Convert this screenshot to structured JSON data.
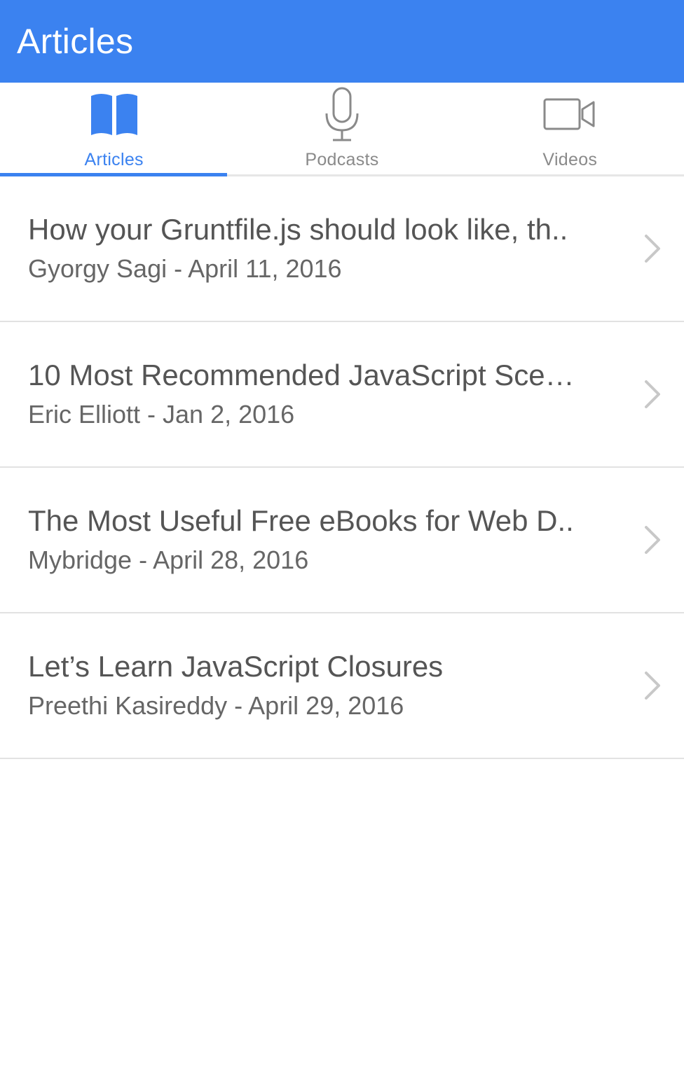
{
  "app_bar": {
    "title": "Articles"
  },
  "colors": {
    "accent": "#3b82f0",
    "inactive_icon": "#8a8a8a",
    "divider": "#e2e2e2",
    "chevron": "#c8c8c8"
  },
  "tabs": [
    {
      "label": "Articles",
      "icon": "book-icon",
      "active": true
    },
    {
      "label": "Podcasts",
      "icon": "microphone-icon",
      "active": false
    },
    {
      "label": "Videos",
      "icon": "video-camera-icon",
      "active": false
    }
  ],
  "articles": [
    {
      "title": "How your Gruntfile.js should look like, th..",
      "subtitle": "Gyorgy Sagi - April 11, 2016"
    },
    {
      "title": "10 Most Recommended JavaScript Sce…",
      "subtitle": "Eric Elliott - Jan 2, 2016"
    },
    {
      "title": "The Most Useful Free eBooks for Web D..",
      "subtitle": "Mybridge - April 28, 2016"
    },
    {
      "title": "Let’s Learn JavaScript Closures",
      "subtitle": "Preethi Kasireddy - April 29, 2016"
    }
  ]
}
